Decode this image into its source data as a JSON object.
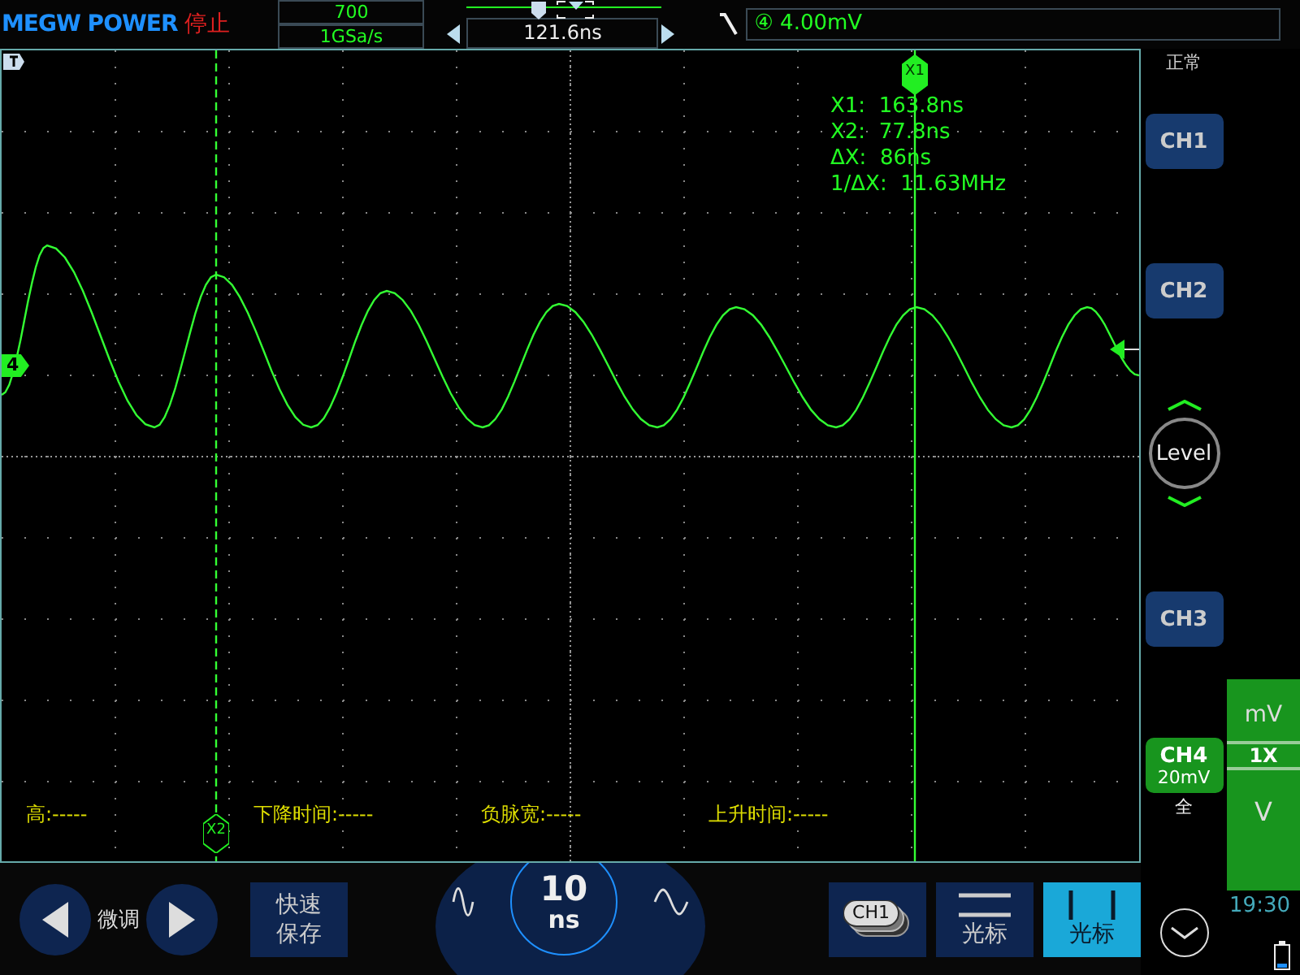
{
  "brand": "MEGW POWER",
  "run_state": "停止",
  "acquisition": {
    "memory_depth": "700",
    "sample_rate": "1GSa/s"
  },
  "horizontal": {
    "position": "121.6ns"
  },
  "trigger": {
    "source": "④",
    "level": "4.00mV",
    "mode": "正常"
  },
  "cursors": [
    {
      "label": "X1",
      "selected": true
    },
    {
      "label": "X2",
      "selected": false
    }
  ],
  "cursor_readout": [
    "X1:  163.8ns",
    "X2:  77.8ns",
    "ΔX:  86ns",
    "1/ΔX:  11.63MHz"
  ],
  "channel_marker": "4",
  "measurements": [
    "高:-----",
    "下降时间:-----",
    "负脉宽:-----",
    "上升时间:-----"
  ],
  "channels": [
    {
      "label": "CH1",
      "active": false
    },
    {
      "label": "CH2",
      "active": false
    },
    {
      "label": "CH3",
      "active": false
    },
    {
      "label": "CH4",
      "active": true,
      "scale": "20mV",
      "coupling": "全"
    }
  ],
  "level_knob": "Level",
  "scale_panel": [
    {
      "label": "mV",
      "selected": false
    },
    {
      "label": "1X",
      "selected": true
    },
    {
      "label": "V",
      "selected": false
    }
  ],
  "clock": "19:30",
  "fine_tune": "微调",
  "quick_save": [
    "快速",
    "保存"
  ],
  "timebase": {
    "value": "10",
    "unit": "ns"
  },
  "menu": [
    {
      "kind": "source",
      "label": "CH1",
      "selected": false
    },
    {
      "kind": "h_cursor",
      "label": "光标",
      "selected": false
    },
    {
      "kind": "v_cursor",
      "label": "光标",
      "selected": true
    }
  ]
}
